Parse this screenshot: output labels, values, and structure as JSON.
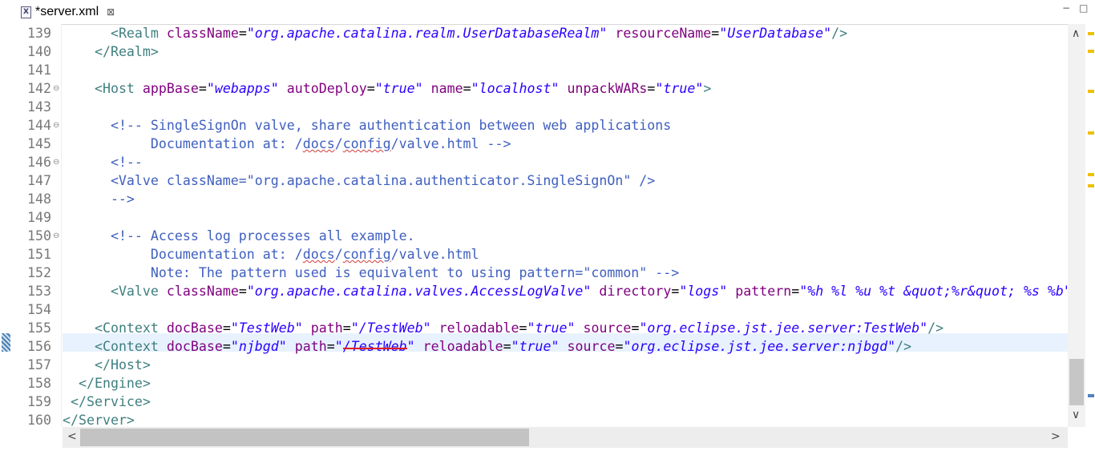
{
  "tab": {
    "title": "*server.xml",
    "icon": "xml-file-icon",
    "close": "⊠"
  },
  "window": {
    "minimize": "−",
    "maximize": "□"
  },
  "editor": {
    "lines": [
      {
        "num": "139",
        "segs": [
          [
            "p",
            "      "
          ],
          [
            "t",
            "<Realm "
          ],
          [
            "a",
            "className"
          ],
          [
            "p",
            "="
          ],
          [
            "v",
            "\"org.apache.catalina.realm.UserDatabaseRealm\""
          ],
          [
            "p",
            " "
          ],
          [
            "a",
            "resourceName"
          ],
          [
            "p",
            "="
          ],
          [
            "v",
            "\"UserDatabase\""
          ],
          [
            "t",
            "/>"
          ]
        ]
      },
      {
        "num": "140",
        "segs": [
          [
            "p",
            "    "
          ],
          [
            "t",
            "</Realm>"
          ]
        ]
      },
      {
        "num": "141",
        "segs": []
      },
      {
        "num": "142",
        "fold": "⊖",
        "segs": [
          [
            "p",
            "    "
          ],
          [
            "t",
            "<Host "
          ],
          [
            "a",
            "appBase"
          ],
          [
            "p",
            "="
          ],
          [
            "v",
            "\"webapps\""
          ],
          [
            "p",
            " "
          ],
          [
            "a",
            "autoDeploy"
          ],
          [
            "p",
            "="
          ],
          [
            "v",
            "\"true\""
          ],
          [
            "p",
            " "
          ],
          [
            "a",
            "name"
          ],
          [
            "p",
            "="
          ],
          [
            "v",
            "\"localhost\""
          ],
          [
            "p",
            " "
          ],
          [
            "a",
            "unpackWARs"
          ],
          [
            "p",
            "="
          ],
          [
            "v",
            "\"true\""
          ],
          [
            "t",
            ">"
          ]
        ]
      },
      {
        "num": "143",
        "segs": []
      },
      {
        "num": "144",
        "fold": "⊖",
        "segs": [
          [
            "p",
            "      "
          ],
          [
            "c",
            "<!-- SingleSignOn valve, share authentication between web applications"
          ]
        ]
      },
      {
        "num": "145",
        "segs": [
          [
            "c",
            "           Documentation at: /"
          ],
          [
            "cs",
            "docs"
          ],
          [
            "c",
            "/"
          ],
          [
            "cs",
            "config"
          ],
          [
            "c",
            "/valve.html -->"
          ]
        ]
      },
      {
        "num": "146",
        "fold": "⊖",
        "segs": [
          [
            "p",
            "      "
          ],
          [
            "c",
            "<!--"
          ]
        ]
      },
      {
        "num": "147",
        "segs": [
          [
            "c",
            "      <Valve className=\"org.apache.catalina.authenticator.SingleSignOn\" />"
          ]
        ]
      },
      {
        "num": "148",
        "segs": [
          [
            "c",
            "      -->"
          ]
        ]
      },
      {
        "num": "149",
        "segs": []
      },
      {
        "num": "150",
        "fold": "⊖",
        "segs": [
          [
            "p",
            "      "
          ],
          [
            "c",
            "<!-- Access log processes all example."
          ]
        ]
      },
      {
        "num": "151",
        "segs": [
          [
            "c",
            "           Documentation at: /"
          ],
          [
            "cs",
            "docs"
          ],
          [
            "c",
            "/"
          ],
          [
            "cs",
            "config"
          ],
          [
            "c",
            "/valve.html"
          ]
        ]
      },
      {
        "num": "152",
        "segs": [
          [
            "c",
            "           Note: The pattern used is equivalent to using pattern=\"common\" -->"
          ]
        ]
      },
      {
        "num": "153",
        "segs": [
          [
            "p",
            "      "
          ],
          [
            "t",
            "<Valve "
          ],
          [
            "a",
            "className"
          ],
          [
            "p",
            "="
          ],
          [
            "v",
            "\"org.apache.catalina.valves.AccessLogValve\""
          ],
          [
            "p",
            " "
          ],
          [
            "a",
            "directory"
          ],
          [
            "p",
            "="
          ],
          [
            "v",
            "\"logs\""
          ],
          [
            "p",
            " "
          ],
          [
            "a",
            "pattern"
          ],
          [
            "p",
            "="
          ],
          [
            "v",
            "\"%h %l %u %t &quot;%r&quot; %s %b\""
          ]
        ]
      },
      {
        "num": "154",
        "segs": []
      },
      {
        "num": "155",
        "segs": [
          [
            "p",
            "    "
          ],
          [
            "t",
            "<Context "
          ],
          [
            "a",
            "docBase"
          ],
          [
            "p",
            "="
          ],
          [
            "v",
            "\"TestWeb\""
          ],
          [
            "p",
            " "
          ],
          [
            "a",
            "path"
          ],
          [
            "p",
            "="
          ],
          [
            "v",
            "\"/TestWeb\""
          ],
          [
            "p",
            " "
          ],
          [
            "a",
            "reloadable"
          ],
          [
            "p",
            "="
          ],
          [
            "v",
            "\"true\""
          ],
          [
            "p",
            " "
          ],
          [
            "a",
            "source"
          ],
          [
            "p",
            "="
          ],
          [
            "v",
            "\"org.eclipse.jst.jee.server:TestWeb\""
          ],
          [
            "t",
            "/>"
          ]
        ]
      },
      {
        "num": "156",
        "segs": [
          [
            "p",
            "    "
          ],
          [
            "t",
            "<Context "
          ],
          [
            "a",
            "docBase"
          ],
          [
            "p",
            "="
          ],
          [
            "v",
            "\"njbgd\""
          ],
          [
            "p",
            " "
          ],
          [
            "a",
            "path"
          ],
          [
            "p",
            "="
          ],
          [
            "v",
            "\""
          ],
          [
            "vx",
            "/TestWeb"
          ],
          [
            "v",
            "\""
          ],
          [
            "p",
            " "
          ],
          [
            "a",
            "reloadable"
          ],
          [
            "p",
            "="
          ],
          [
            "v",
            "\"true\""
          ],
          [
            "p",
            " "
          ],
          [
            "a",
            "source"
          ],
          [
            "p",
            "="
          ],
          [
            "v",
            "\"org.eclipse.jst.jee.server:njbgd\""
          ],
          [
            "t",
            "/>"
          ]
        ]
      },
      {
        "num": "157",
        "segs": [
          [
            "p",
            "    "
          ],
          [
            "t",
            "</Host>"
          ]
        ]
      },
      {
        "num": "158",
        "segs": [
          [
            "p",
            "  "
          ],
          [
            "t",
            "</Engine>"
          ]
        ]
      },
      {
        "num": "159",
        "segs": [
          [
            "p",
            " "
          ],
          [
            "t",
            "</Service>"
          ]
        ]
      },
      {
        "num": "160",
        "segs": [
          [
            "t",
            "</Server>"
          ]
        ]
      }
    ]
  },
  "scroll": {
    "up": "∧",
    "down": "∨",
    "left": "<",
    "right": ">"
  },
  "colors": {
    "tag": "#3f7f7f",
    "attr": "#7f007f",
    "value": "#2a00ff",
    "comment": "#3f5fbf",
    "current_line": "#e8f2fe"
  }
}
